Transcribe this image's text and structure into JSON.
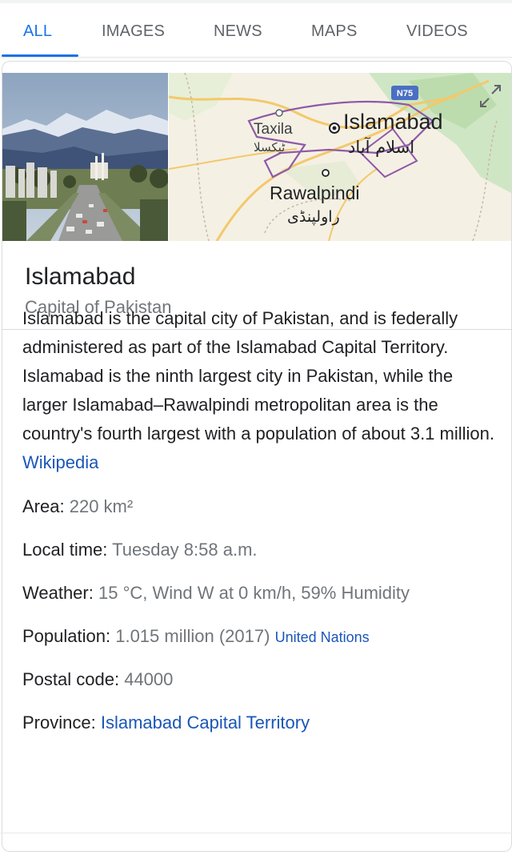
{
  "tabs": {
    "all": "ALL",
    "images": "IMAGES",
    "news": "NEWS",
    "maps": "MAPS",
    "videos": "VIDEOS"
  },
  "map": {
    "road_shield": "N75",
    "taxila_en": "Taxila",
    "taxila_ur": "ٹیکسلا",
    "islamabad_en": "Islamabad",
    "islamabad_ur": "اسلام آباد",
    "rawalpindi_en": "Rawalpindi",
    "rawalpindi_ur": "راولپنڈی",
    "expand_icon": "expand-icon"
  },
  "entity": {
    "title": "Islamabad",
    "subtitle": "Capital of Pakistan"
  },
  "description": {
    "text": "Islamabad is the capital city of Pakistan, and is federally administered as part of the Islamabad Capital Territory. Islamabad is the ninth largest city in Pakistan, while the larger Islamabad–Rawalpindi metropolitan area is the country's fourth largest with a population of about 3.1 million.",
    "source": "Wikipedia"
  },
  "facts": {
    "area": {
      "label": "Area:",
      "value": "220 km²"
    },
    "local_time": {
      "label": "Local time:",
      "value": "Tuesday 8:58 a.m."
    },
    "weather": {
      "label": "Weather:",
      "value": "15 °C, Wind W at 0 km/h, 59% Humidity"
    },
    "population": {
      "label": "Population:",
      "value": "1.015 million (2017)",
      "source": "United Nations"
    },
    "postal_code": {
      "label": "Postal code:",
      "value": "44000"
    },
    "province": {
      "label": "Province:",
      "value": "Islamabad Capital Territory"
    }
  },
  "colors": {
    "accent": "#1a73e8",
    "link": "#1a56b8",
    "muted": "#70757a"
  }
}
